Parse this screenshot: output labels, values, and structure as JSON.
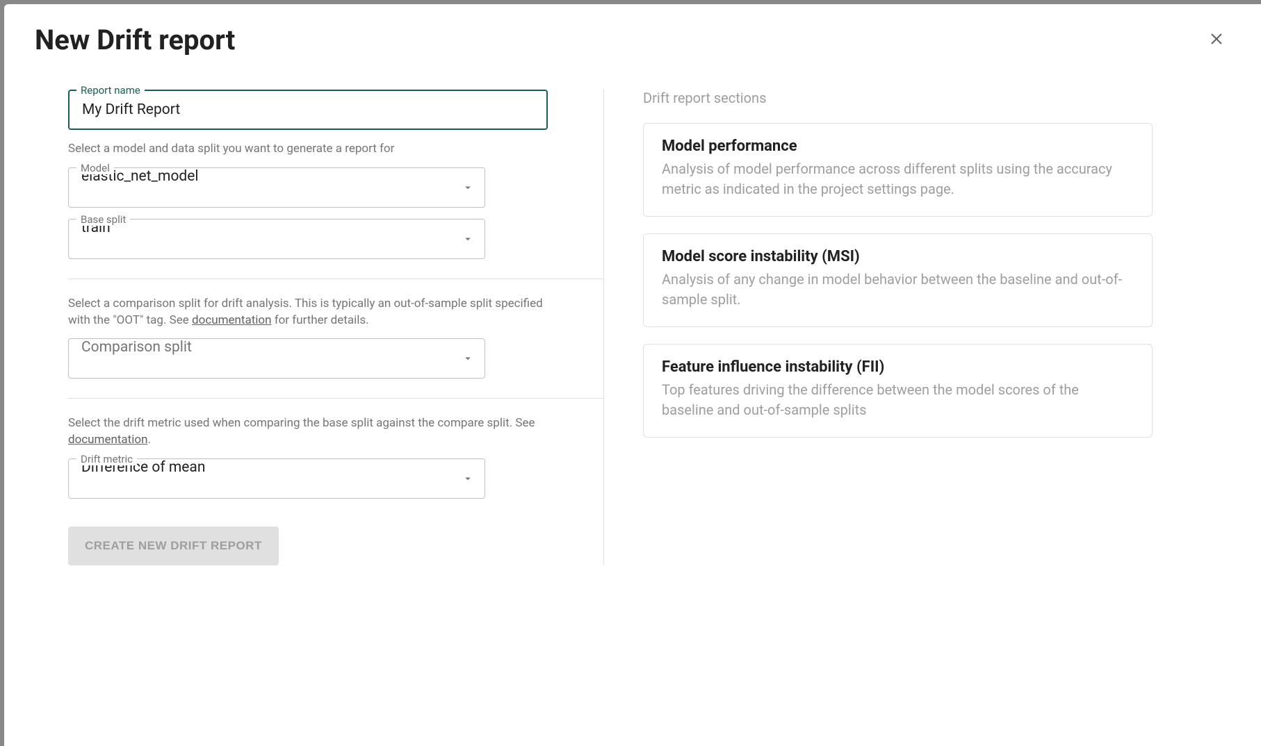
{
  "modal": {
    "title": "New Drift report"
  },
  "form": {
    "report_name": {
      "label": "Report name",
      "value": "My Drift Report"
    },
    "helper_model_split": "Select a model and data split you want to generate a report for",
    "model": {
      "label": "Model",
      "value": "elastic_net_model"
    },
    "base_split": {
      "label": "Base split",
      "value": "train"
    },
    "helper_comparison_pre": "Select a comparison split for drift analysis. This is typically an out-of-sample split specified with the \"OOT\" tag. See ",
    "helper_comparison_link": "documentation",
    "helper_comparison_post": " for further details.",
    "comparison_split": {
      "placeholder": "Comparison split"
    },
    "helper_drift_pre": "Select the drift metric used when comparing the base split against the compare split. See ",
    "helper_drift_link": "documentation",
    "helper_drift_post": ".",
    "drift_metric": {
      "label": "Drift metric",
      "value": "Difference of mean"
    },
    "submit_label": "CREATE NEW DRIFT REPORT"
  },
  "sections": {
    "title": "Drift report sections",
    "items": [
      {
        "title": "Model performance",
        "desc": "Analysis of model performance across different splits using the accuracy metric as indicated in the project settings page."
      },
      {
        "title": "Model score instability (MSI)",
        "desc": "Analysis of any change in model behavior between the baseline and out-of-sample split."
      },
      {
        "title": "Feature influence instability (FII)",
        "desc": "Top features driving the difference between the model scores of the baseline and out-of-sample splits"
      }
    ]
  }
}
